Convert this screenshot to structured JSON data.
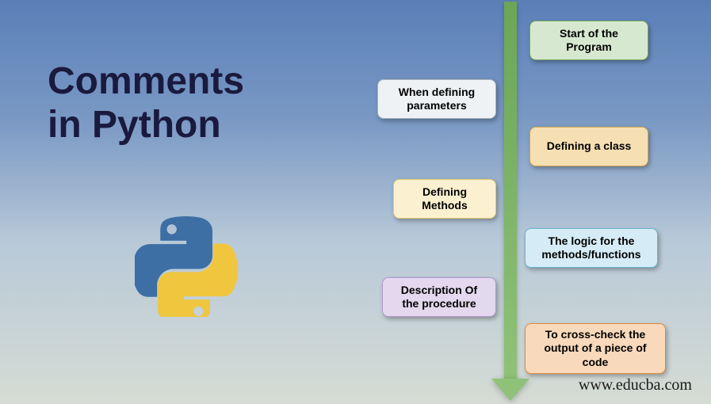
{
  "title_line1": "Comments",
  "title_line2": "in Python",
  "boxes": {
    "r1": "Start of the Program",
    "l1": "When defining parameters",
    "r2": "Defining a class",
    "l2": "Defining Methods",
    "r3": "The logic for the methods/functions",
    "l3": "Description Of the procedure",
    "r4": "To cross-check the output of a piece of code"
  },
  "footer": "www.educba.com"
}
